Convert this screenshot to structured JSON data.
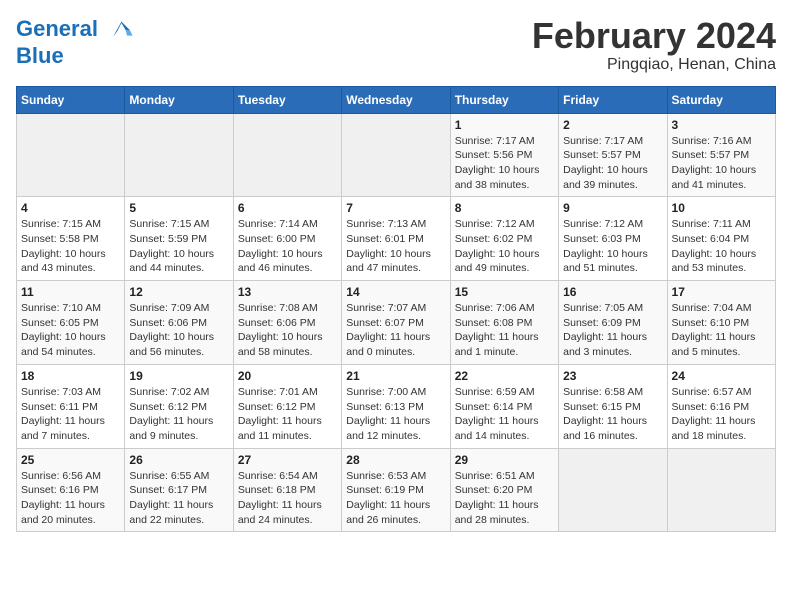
{
  "logo": {
    "line1": "General",
    "line2": "Blue"
  },
  "title": "February 2024",
  "location": "Pingqiao, Henan, China",
  "days_of_week": [
    "Sunday",
    "Monday",
    "Tuesday",
    "Wednesday",
    "Thursday",
    "Friday",
    "Saturday"
  ],
  "weeks": [
    [
      {
        "day": "",
        "empty": true
      },
      {
        "day": "",
        "empty": true
      },
      {
        "day": "",
        "empty": true
      },
      {
        "day": "",
        "empty": true
      },
      {
        "day": "1",
        "sunrise": "7:17 AM",
        "sunset": "5:56 PM",
        "daylight": "10 hours and 38 minutes."
      },
      {
        "day": "2",
        "sunrise": "7:17 AM",
        "sunset": "5:57 PM",
        "daylight": "10 hours and 39 minutes."
      },
      {
        "day": "3",
        "sunrise": "7:16 AM",
        "sunset": "5:57 PM",
        "daylight": "10 hours and 41 minutes."
      }
    ],
    [
      {
        "day": "4",
        "sunrise": "7:15 AM",
        "sunset": "5:58 PM",
        "daylight": "10 hours and 43 minutes."
      },
      {
        "day": "5",
        "sunrise": "7:15 AM",
        "sunset": "5:59 PM",
        "daylight": "10 hours and 44 minutes."
      },
      {
        "day": "6",
        "sunrise": "7:14 AM",
        "sunset": "6:00 PM",
        "daylight": "10 hours and 46 minutes."
      },
      {
        "day": "7",
        "sunrise": "7:13 AM",
        "sunset": "6:01 PM",
        "daylight": "10 hours and 47 minutes."
      },
      {
        "day": "8",
        "sunrise": "7:12 AM",
        "sunset": "6:02 PM",
        "daylight": "10 hours and 49 minutes."
      },
      {
        "day": "9",
        "sunrise": "7:12 AM",
        "sunset": "6:03 PM",
        "daylight": "10 hours and 51 minutes."
      },
      {
        "day": "10",
        "sunrise": "7:11 AM",
        "sunset": "6:04 PM",
        "daylight": "10 hours and 53 minutes."
      }
    ],
    [
      {
        "day": "11",
        "sunrise": "7:10 AM",
        "sunset": "6:05 PM",
        "daylight": "10 hours and 54 minutes."
      },
      {
        "day": "12",
        "sunrise": "7:09 AM",
        "sunset": "6:06 PM",
        "daylight": "10 hours and 56 minutes."
      },
      {
        "day": "13",
        "sunrise": "7:08 AM",
        "sunset": "6:06 PM",
        "daylight": "10 hours and 58 minutes."
      },
      {
        "day": "14",
        "sunrise": "7:07 AM",
        "sunset": "6:07 PM",
        "daylight": "11 hours and 0 minutes."
      },
      {
        "day": "15",
        "sunrise": "7:06 AM",
        "sunset": "6:08 PM",
        "daylight": "11 hours and 1 minute."
      },
      {
        "day": "16",
        "sunrise": "7:05 AM",
        "sunset": "6:09 PM",
        "daylight": "11 hours and 3 minutes."
      },
      {
        "day": "17",
        "sunrise": "7:04 AM",
        "sunset": "6:10 PM",
        "daylight": "11 hours and 5 minutes."
      }
    ],
    [
      {
        "day": "18",
        "sunrise": "7:03 AM",
        "sunset": "6:11 PM",
        "daylight": "11 hours and 7 minutes."
      },
      {
        "day": "19",
        "sunrise": "7:02 AM",
        "sunset": "6:12 PM",
        "daylight": "11 hours and 9 minutes."
      },
      {
        "day": "20",
        "sunrise": "7:01 AM",
        "sunset": "6:12 PM",
        "daylight": "11 hours and 11 minutes."
      },
      {
        "day": "21",
        "sunrise": "7:00 AM",
        "sunset": "6:13 PM",
        "daylight": "11 hours and 12 minutes."
      },
      {
        "day": "22",
        "sunrise": "6:59 AM",
        "sunset": "6:14 PM",
        "daylight": "11 hours and 14 minutes."
      },
      {
        "day": "23",
        "sunrise": "6:58 AM",
        "sunset": "6:15 PM",
        "daylight": "11 hours and 16 minutes."
      },
      {
        "day": "24",
        "sunrise": "6:57 AM",
        "sunset": "6:16 PM",
        "daylight": "11 hours and 18 minutes."
      }
    ],
    [
      {
        "day": "25",
        "sunrise": "6:56 AM",
        "sunset": "6:16 PM",
        "daylight": "11 hours and 20 minutes."
      },
      {
        "day": "26",
        "sunrise": "6:55 AM",
        "sunset": "6:17 PM",
        "daylight": "11 hours and 22 minutes."
      },
      {
        "day": "27",
        "sunrise": "6:54 AM",
        "sunset": "6:18 PM",
        "daylight": "11 hours and 24 minutes."
      },
      {
        "day": "28",
        "sunrise": "6:53 AM",
        "sunset": "6:19 PM",
        "daylight": "11 hours and 26 minutes."
      },
      {
        "day": "29",
        "sunrise": "6:51 AM",
        "sunset": "6:20 PM",
        "daylight": "11 hours and 28 minutes."
      },
      {
        "day": "",
        "empty": true
      },
      {
        "day": "",
        "empty": true
      }
    ]
  ]
}
